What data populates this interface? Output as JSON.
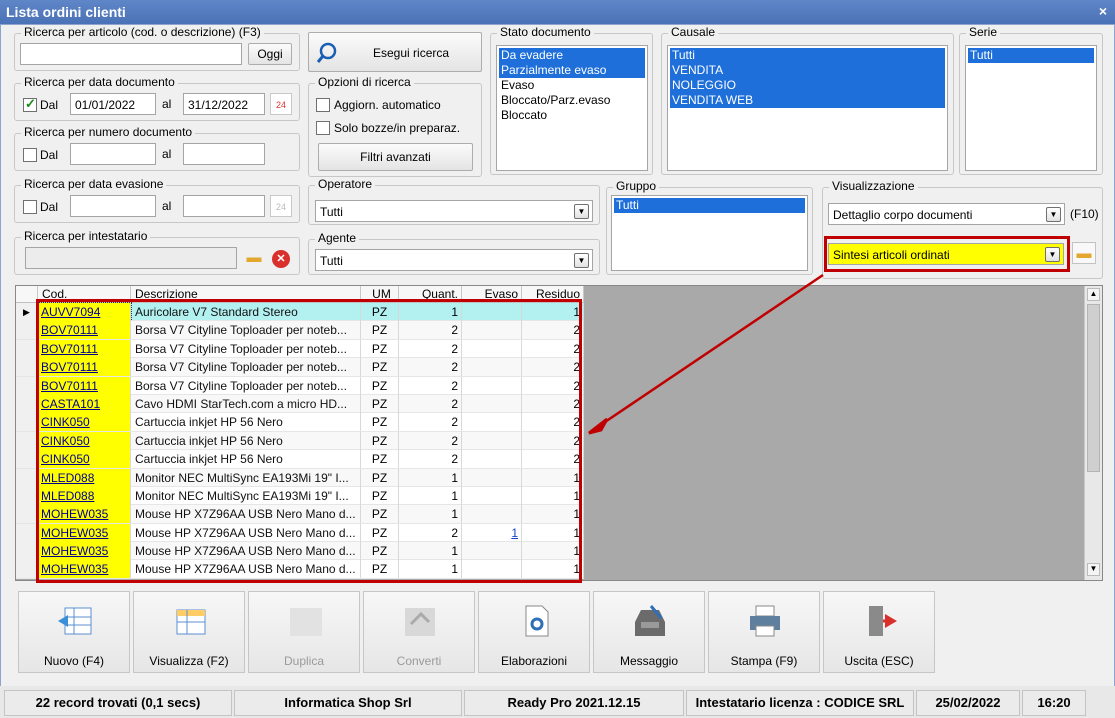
{
  "window": {
    "title": "Lista ordini clienti",
    "close": "×"
  },
  "ricerca_articolo": {
    "legend": "Ricerca per articolo (cod. o descrizione) (F3)",
    "value": "",
    "button": "Oggi"
  },
  "esegui": {
    "label": "Esegui ricerca"
  },
  "data_documento": {
    "legend": "Ricerca per data documento",
    "dal_label": "Dal",
    "dal_checked": true,
    "from": "01/01/2022",
    "al_label": "al",
    "to": "31/12/2022"
  },
  "opzioni": {
    "legend": "Opzioni di ricerca",
    "aggiorn": "Aggiorn. automatico",
    "solo_bozze": "Solo bozze/in preparaz.",
    "filtri": "Filtri avanzati"
  },
  "numero_documento": {
    "legend": "Ricerca per numero documento",
    "dal_label": "Dal",
    "al_label": "al",
    "from": "",
    "to": ""
  },
  "data_evasione": {
    "legend": "Ricerca per data evasione",
    "dal_label": "Dal",
    "al_label": "al",
    "from": "",
    "to": ""
  },
  "intestatario": {
    "legend": "Ricerca per intestatario",
    "value": ""
  },
  "stato_documento": {
    "legend": "Stato documento",
    "items": [
      "Da evadere",
      "Parzialmente evaso",
      "Evaso",
      "Bloccato/Parz.evaso",
      "Bloccato"
    ],
    "selected": [
      0,
      1
    ]
  },
  "causale": {
    "legend": "Causale",
    "items": [
      "Tutti",
      "VENDITA",
      "NOLEGGIO",
      "VENDITA WEB"
    ]
  },
  "serie": {
    "legend": "Serie",
    "items": [
      "Tutti"
    ]
  },
  "operatore": {
    "legend": "Operatore",
    "value": "Tutti"
  },
  "agente": {
    "legend": "Agente",
    "value": "Tutti"
  },
  "gruppo": {
    "legend": "Gruppo",
    "items": [
      "Tutti"
    ]
  },
  "visualizzazione": {
    "legend": "Visualizzazione",
    "dettaglio": "Dettaglio corpo documenti",
    "shortcut": "(F10)",
    "sintesi": "Sintesi articoli ordinati",
    "highlight_color": "#ffff00",
    "annotation_color": "#c00000"
  },
  "grid": {
    "headers": {
      "cod": "Cod.",
      "desc": "Descrizione",
      "um": "UM",
      "quant": "Quant.",
      "evaso": "Evaso",
      "residuo": "Residuo"
    },
    "rows": [
      {
        "cod": "AUVV7094",
        "desc": "Auricolare V7 Standard Stereo",
        "um": "PZ",
        "q": "1",
        "ev": "",
        "res": "1"
      },
      {
        "cod": "BOV70111",
        "desc": "Borsa V7 Cityline Toploader per noteb...",
        "um": "PZ",
        "q": "2",
        "ev": "",
        "res": "2"
      },
      {
        "cod": "BOV70111",
        "desc": "Borsa V7 Cityline Toploader per noteb...",
        "um": "PZ",
        "q": "2",
        "ev": "",
        "res": "2"
      },
      {
        "cod": "BOV70111",
        "desc": "Borsa V7 Cityline Toploader per noteb...",
        "um": "PZ",
        "q": "2",
        "ev": "",
        "res": "2"
      },
      {
        "cod": "BOV70111",
        "desc": "Borsa V7 Cityline Toploader per noteb...",
        "um": "PZ",
        "q": "2",
        "ev": "",
        "res": "2"
      },
      {
        "cod": "CASTA101",
        "desc": "Cavo HDMI StarTech.com a micro HD...",
        "um": "PZ",
        "q": "2",
        "ev": "",
        "res": "2"
      },
      {
        "cod": "CINK050",
        "desc": "Cartuccia inkjet HP 56 Nero",
        "um": "PZ",
        "q": "2",
        "ev": "",
        "res": "2"
      },
      {
        "cod": "CINK050",
        "desc": "Cartuccia inkjet HP 56 Nero",
        "um": "PZ",
        "q": "2",
        "ev": "",
        "res": "2"
      },
      {
        "cod": "CINK050",
        "desc": "Cartuccia inkjet HP 56 Nero",
        "um": "PZ",
        "q": "2",
        "ev": "",
        "res": "2"
      },
      {
        "cod": "MLED088",
        "desc": "Monitor NEC MultiSync EA193Mi 19\" I...",
        "um": "PZ",
        "q": "1",
        "ev": "",
        "res": "1"
      },
      {
        "cod": "MLED088",
        "desc": "Monitor NEC MultiSync EA193Mi 19\" I...",
        "um": "PZ",
        "q": "1",
        "ev": "",
        "res": "1"
      },
      {
        "cod": "MOHEW035",
        "desc": "Mouse HP X7Z96AA USB Nero Mano d...",
        "um": "PZ",
        "q": "1",
        "ev": "",
        "res": "1"
      },
      {
        "cod": "MOHEW035",
        "desc": "Mouse HP X7Z96AA USB Nero Mano d...",
        "um": "PZ",
        "q": "2",
        "ev": "1",
        "res": "1"
      },
      {
        "cod": "MOHEW035",
        "desc": "Mouse HP X7Z96AA USB Nero Mano d...",
        "um": "PZ",
        "q": "1",
        "ev": "",
        "res": "1"
      },
      {
        "cod": "MOHEW035",
        "desc": "Mouse HP X7Z96AA USB Nero Mano d...",
        "um": "PZ",
        "q": "1",
        "ev": "",
        "res": "1"
      }
    ]
  },
  "toolbar": [
    {
      "label": "Nuovo (F4)",
      "icon": "new-grid-icon",
      "enabled": true
    },
    {
      "label": "Visualizza (F2)",
      "icon": "view-grid-icon",
      "enabled": true
    },
    {
      "label": "Duplica",
      "icon": "duplicate-icon",
      "enabled": false
    },
    {
      "label": "Converti",
      "icon": "convert-icon",
      "enabled": false
    },
    {
      "label": "Elaborazioni",
      "icon": "document-gear-icon",
      "enabled": true
    },
    {
      "label": "Messaggio",
      "icon": "message-tray-icon",
      "enabled": true
    },
    {
      "label": "Stampa (F9)",
      "icon": "printer-icon",
      "enabled": true
    },
    {
      "label": "Uscita (ESC)",
      "icon": "exit-door-icon",
      "enabled": true
    }
  ],
  "status": {
    "records": "22 record trovati (0,1 secs)",
    "company": "Informatica Shop Srl",
    "version": "Ready Pro 2021.12.15",
    "license": "Intestatario licenza : CODICE SRL",
    "date": "25/02/2022",
    "time": "16:20"
  }
}
